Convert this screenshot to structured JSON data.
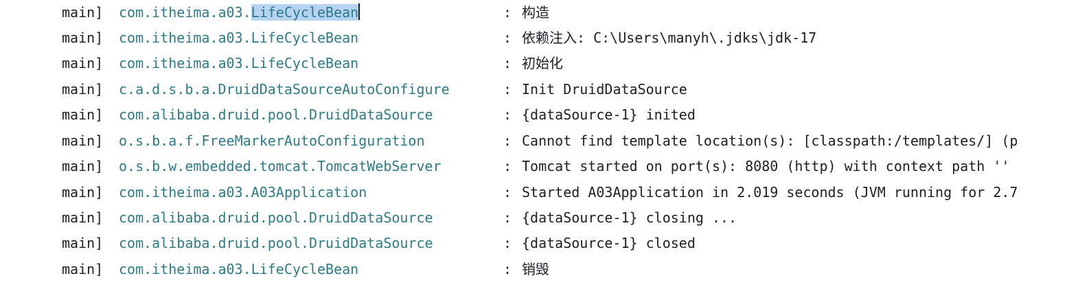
{
  "console": {
    "lines": [
      {
        "thread": "main]",
        "logger_prefix": "com.itheima.a03.",
        "logger_selected": "LifeCycleBean",
        "separator": ":",
        "message": "构造"
      },
      {
        "thread": "main]",
        "logger": "com.itheima.a03.LifeCycleBean",
        "separator": ":",
        "message": "依赖注入: C:\\Users\\manyh\\.jdks\\jdk-17"
      },
      {
        "thread": "main]",
        "logger": "com.itheima.a03.LifeCycleBean",
        "separator": ":",
        "message": "初始化"
      },
      {
        "thread": "main]",
        "logger": "c.a.d.s.b.a.DruidDataSourceAutoConfigure",
        "separator": ":",
        "message": "Init DruidDataSource"
      },
      {
        "thread": "main]",
        "logger": "com.alibaba.druid.pool.DruidDataSource",
        "separator": ":",
        "message": "{dataSource-1} inited"
      },
      {
        "thread": "main]",
        "logger": "o.s.b.a.f.FreeMarkerAutoConfiguration",
        "separator": ":",
        "message": "Cannot find template location(s): [classpath:/templates/] (p"
      },
      {
        "thread": "main]",
        "logger": "o.s.b.w.embedded.tomcat.TomcatWebServer",
        "separator": ":",
        "message": "Tomcat started on port(s): 8080 (http) with context path ''"
      },
      {
        "thread": "main]",
        "logger": "com.itheima.a03.A03Application",
        "separator": ":",
        "message": "Started A03Application in 2.019 seconds (JVM running for 2.7"
      },
      {
        "thread": "main]",
        "logger": "com.alibaba.druid.pool.DruidDataSource",
        "separator": ":",
        "message": "{dataSource-1} closing ..."
      },
      {
        "thread": "main]",
        "logger": "com.alibaba.druid.pool.DruidDataSource",
        "separator": ":",
        "message": "{dataSource-1} closed"
      },
      {
        "thread": "main]",
        "logger": "com.itheima.a03.LifeCycleBean",
        "separator": ":",
        "message": "销毁"
      }
    ]
  },
  "colors": {
    "background": "#ffffff",
    "logger_text": "#2b7c86",
    "plain_text": "#1d1f22",
    "selection": "#b7d3f3"
  }
}
